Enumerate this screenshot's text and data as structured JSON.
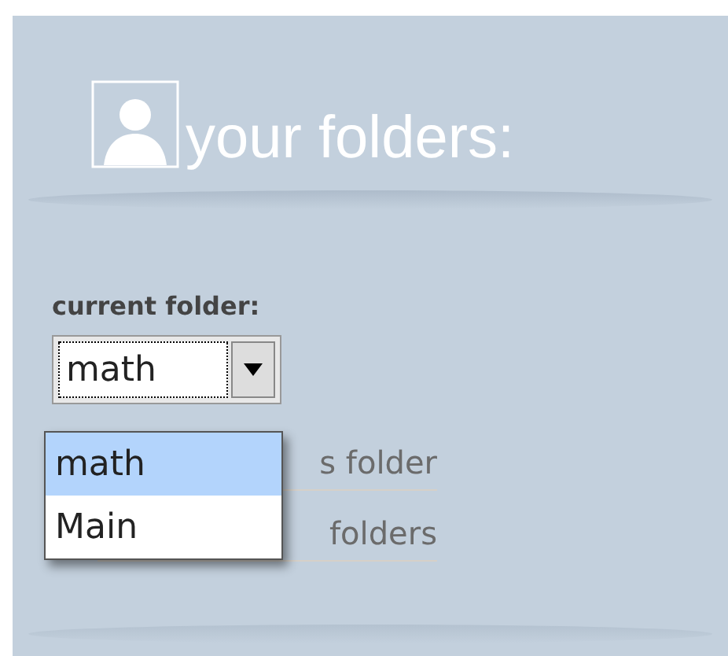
{
  "header": {
    "title": "your folders:"
  },
  "current_folder": {
    "label": "current folder:",
    "select": {
      "value": "math",
      "expanded": true,
      "options": [
        {
          "label": "math",
          "selected": true
        },
        {
          "label": "Main",
          "selected": false
        }
      ]
    }
  },
  "links": [
    "s folder",
    "folders"
  ]
}
